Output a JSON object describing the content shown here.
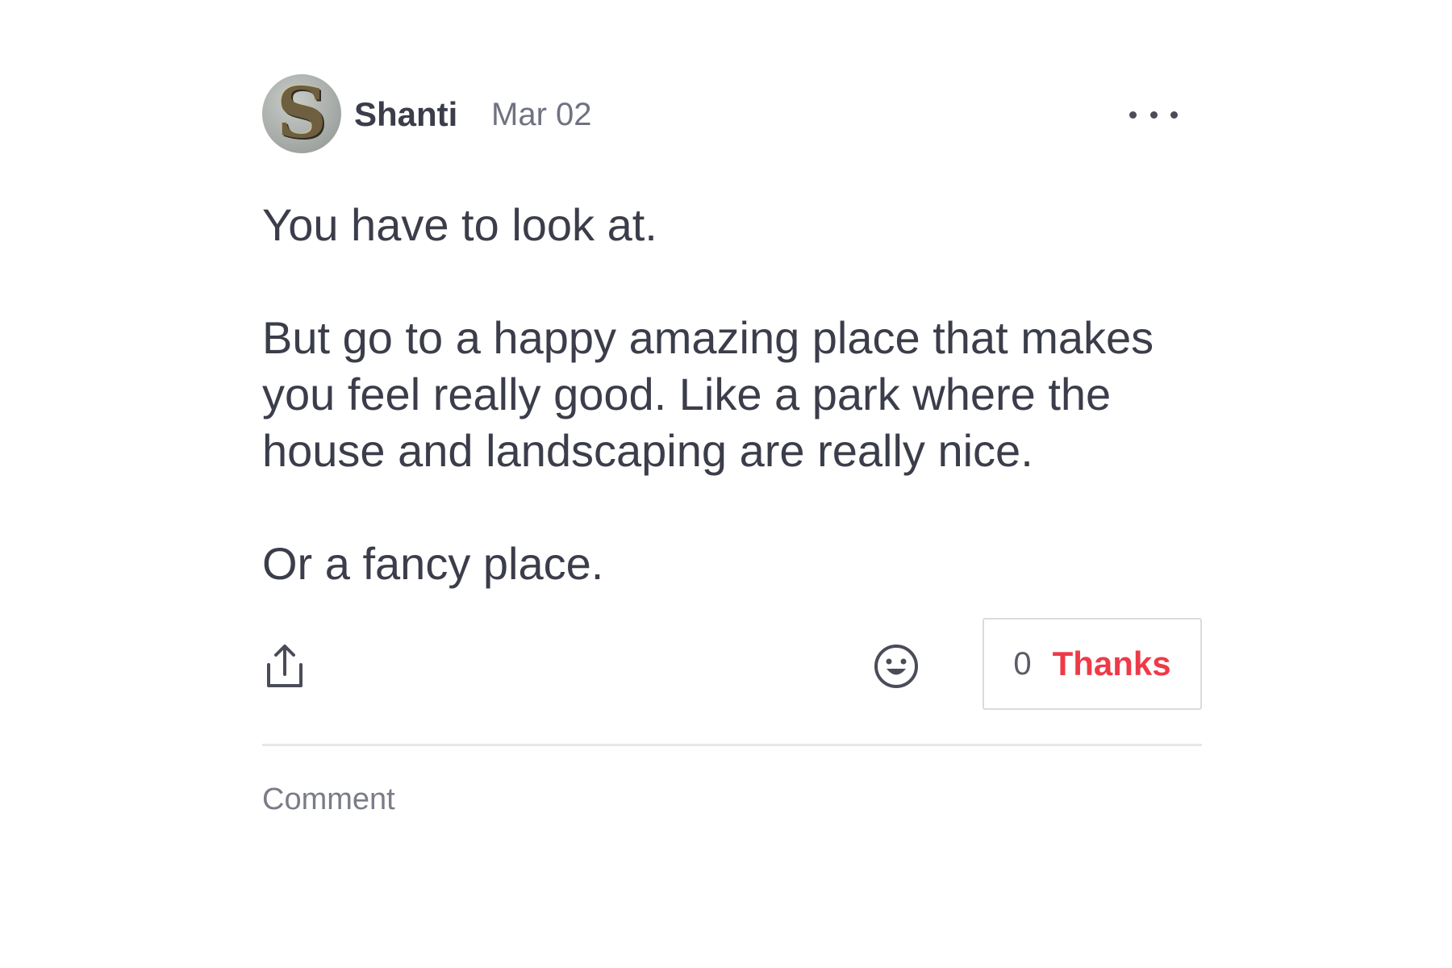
{
  "post": {
    "author": "Shanti",
    "avatar_initial": "S",
    "date": "Mar 02",
    "paragraphs": [
      "You have to look at.",
      "But go to a happy amazing place that makes you feel really good. Like a park where the house and landscaping are really nice.",
      "Or a fancy place."
    ]
  },
  "actions": {
    "share_icon": "share-icon",
    "emoji_icon": "emoji-smile-icon",
    "more_icon": "more-horizontal-icon",
    "thanks_count": "0",
    "thanks_label": "Thanks"
  },
  "comment": {
    "placeholder": "Comment"
  },
  "colors": {
    "accent": "#ee3a48",
    "text": "#3b3d4a",
    "muted": "#6f7280",
    "divider": "#e6e7ea"
  }
}
